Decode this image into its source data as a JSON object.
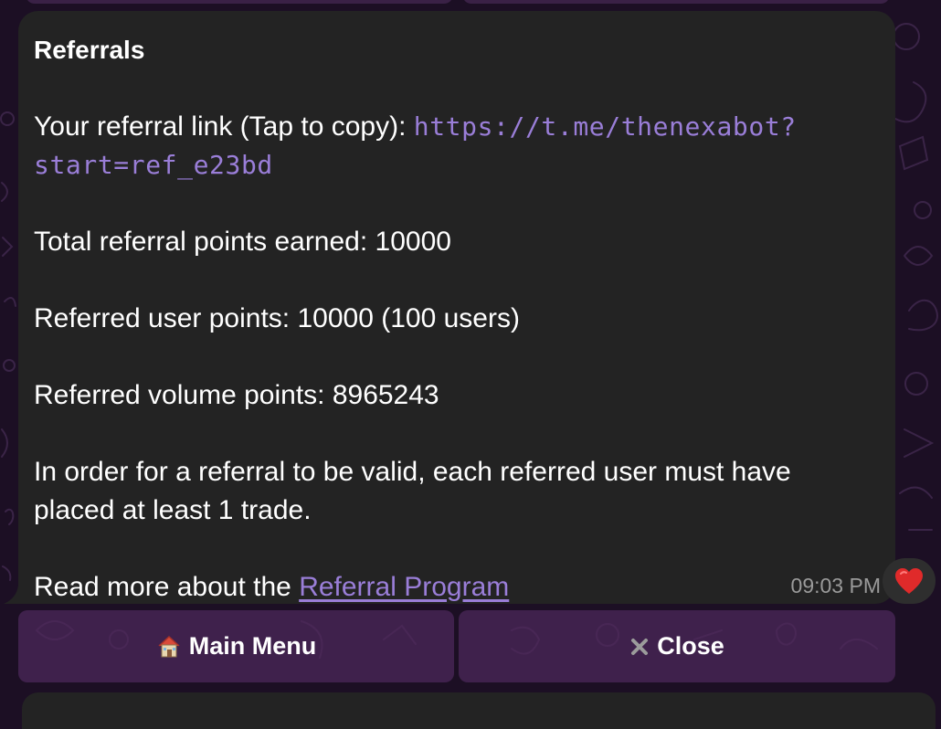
{
  "message": {
    "title": "Referrals",
    "link_prefix": "Your referral link (Tap to copy): ",
    "link_part1": "https://t.me/thenexabot?",
    "link_part2": "start=ref_e23bd",
    "total_points": "Total referral points earned: 10000",
    "user_points": "Referred user points: 10000 (100 users)",
    "volume_points": "Referred volume points: 8965243",
    "validity_line1": "In order for a referral to be valid, each referred user must have",
    "validity_line2": "placed at least 1 trade.",
    "read_more_prefix": "Read more about the ",
    "read_more_link": "Referral Program",
    "time": "09:03 PM"
  },
  "reaction": {
    "icon": "heart-icon",
    "color": "#e02a2a"
  },
  "keyboard": {
    "main_menu": {
      "icon": "house-icon",
      "label": "Main Menu"
    },
    "close": {
      "icon": "x-icon",
      "label": "Close"
    }
  },
  "colors": {
    "bubble": "#232323",
    "link": "#9a7ed8",
    "wallpaper": "#1c0f24",
    "keyboard_button": "#4e285c"
  }
}
